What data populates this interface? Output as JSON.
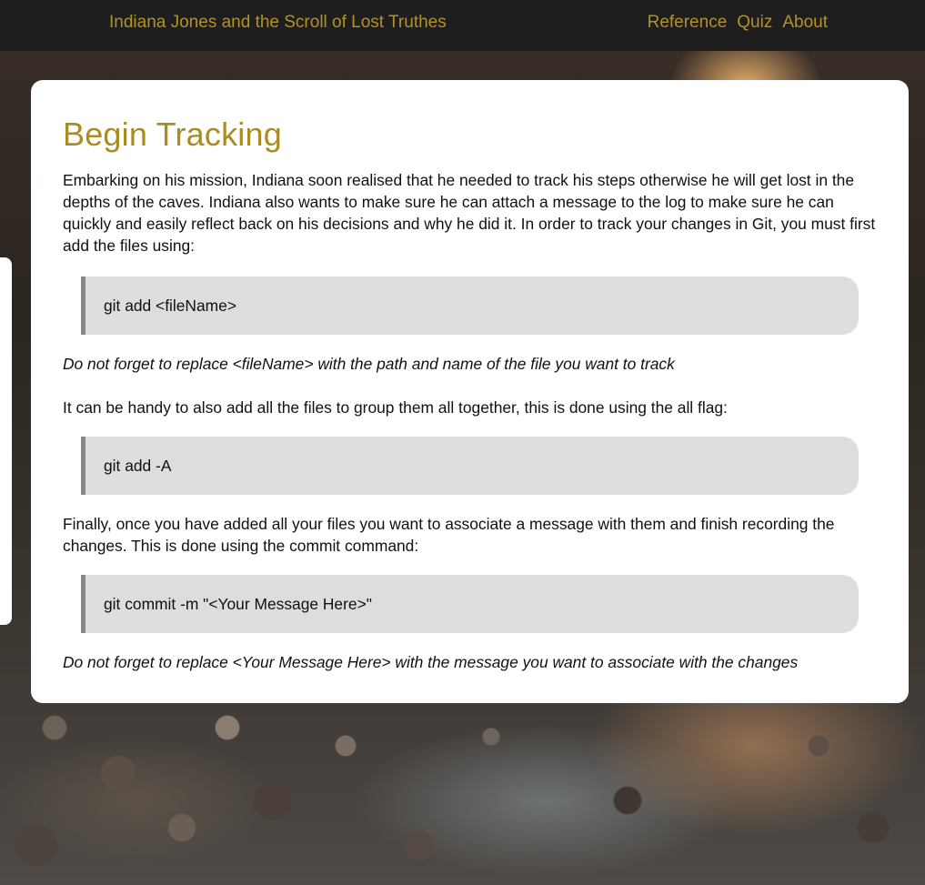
{
  "navbar": {
    "brand": "Indiana Jones and the Scroll of Lost Truthes",
    "links": [
      "Reference",
      "Quiz",
      "About"
    ]
  },
  "content": {
    "title": "Begin Tracking",
    "intro": "Embarking on his mission, Indiana soon realised that he needed to track his steps otherwise he will get lost in the depths of the caves. Indiana also wants to make sure he can attach a message to the log to make sure he can quickly and easily reflect back on his decisions and why he did it. In order to track your changes in Git, you must first add the files using:",
    "code1": "git add <fileName>",
    "note1": "Do not forget to replace <fileName> with the path and name of the file you want to track",
    "para2": "It can be handy to also add all the files to group them all together, this is done using the all flag:",
    "code2": "git add -A",
    "para3": "Finally, once you have added all your files you want to associate a message with them and finish recording the changes. This is done using the commit command:",
    "code3": "git commit -m \"<Your Message Here>\"",
    "note2": "Do not forget to replace <Your Message Here> with the message you want to associate with the changes"
  },
  "colors": {
    "navbar_bg": "#1e1e1e",
    "accent_gold": "#b29129",
    "title_gold": "#a98d20",
    "code_bg": "#dddddd",
    "code_border": "#888888"
  }
}
